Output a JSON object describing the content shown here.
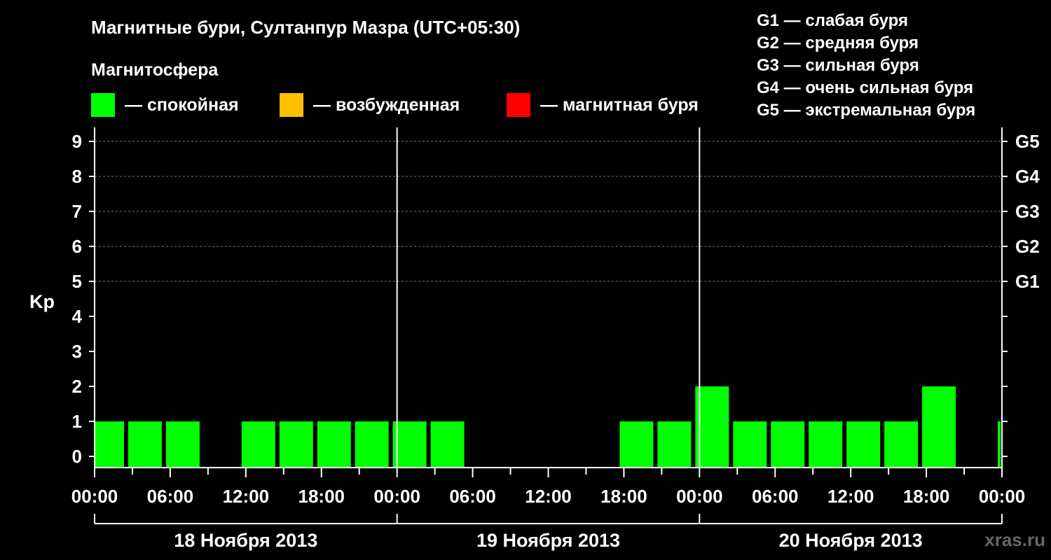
{
  "title": "Магнитные бури, Султанпур Мазра (UTC+05:30)",
  "legend": {
    "heading": "Магнитосфера",
    "items": [
      {
        "label": "— спокойная",
        "color": "#00ff00"
      },
      {
        "label": "— возбужденная",
        "color": "#ffc000"
      },
      {
        "label": "— магнитная буря",
        "color": "#ff0000"
      }
    ]
  },
  "g_scale": [
    "G1 — слабая буря",
    "G2 — средняя буря",
    "G3 — сильная буря",
    "G4 — очень сильная буря",
    "G5 — экстремальная буря"
  ],
  "watermark": "xras.ru",
  "chart_data": {
    "type": "bar",
    "ylabel": "Kp",
    "ylim": [
      0,
      9
    ],
    "yticks": [
      "0",
      "1",
      "2",
      "3",
      "4",
      "5",
      "6",
      "7",
      "8",
      "9"
    ],
    "right_axis_labels": [
      {
        "kp": 5,
        "label": "G1"
      },
      {
        "kp": 6,
        "label": "G2"
      },
      {
        "kp": 7,
        "label": "G3"
      },
      {
        "kp": 8,
        "label": "G4"
      },
      {
        "kp": 9,
        "label": "G5"
      }
    ],
    "grid": true,
    "x_hours_range": [
      0,
      72
    ],
    "xtick_labels": [
      "00:00",
      "06:00",
      "12:00",
      "18:00",
      "00:00",
      "06:00",
      "12:00",
      "18:00",
      "00:00",
      "06:00",
      "12:00",
      "18:00",
      "00:00"
    ],
    "days": [
      "18 Ноября 2013",
      "19 Ноября 2013",
      "20 Ноября 2013"
    ],
    "bars": [
      {
        "start": 0,
        "end": 2.5,
        "kp": 1
      },
      {
        "start": 2.5,
        "end": 5.5,
        "kp": 1
      },
      {
        "start": 5.5,
        "end": 8.5,
        "kp": 1
      },
      {
        "start": 8.5,
        "end": 11.5,
        "kp": 0
      },
      {
        "start": 11.5,
        "end": 14.5,
        "kp": 1
      },
      {
        "start": 14.5,
        "end": 17.5,
        "kp": 1
      },
      {
        "start": 17.5,
        "end": 20.5,
        "kp": 1
      },
      {
        "start": 20.5,
        "end": 23.5,
        "kp": 1
      },
      {
        "start": 23.5,
        "end": 26.5,
        "kp": 1
      },
      {
        "start": 26.5,
        "end": 29.5,
        "kp": 1
      },
      {
        "start": 29.5,
        "end": 32.5,
        "kp": 0
      },
      {
        "start": 32.5,
        "end": 35.5,
        "kp": 0
      },
      {
        "start": 35.5,
        "end": 38.5,
        "kp": 0
      },
      {
        "start": 38.5,
        "end": 41.5,
        "kp": 0
      },
      {
        "start": 41.5,
        "end": 44.5,
        "kp": 1
      },
      {
        "start": 44.5,
        "end": 47.5,
        "kp": 1
      },
      {
        "start": 47.5,
        "end": 50.5,
        "kp": 2
      },
      {
        "start": 50.5,
        "end": 53.5,
        "kp": 1
      },
      {
        "start": 53.5,
        "end": 56.5,
        "kp": 1
      },
      {
        "start": 56.5,
        "end": 59.5,
        "kp": 1
      },
      {
        "start": 59.5,
        "end": 62.5,
        "kp": 1
      },
      {
        "start": 62.5,
        "end": 65.5,
        "kp": 1
      },
      {
        "start": 65.5,
        "end": 68.5,
        "kp": 2
      },
      {
        "start": 68.5,
        "end": 71.5,
        "kp": 0
      },
      {
        "start": 71.5,
        "end": 72,
        "kp": 1
      }
    ]
  }
}
